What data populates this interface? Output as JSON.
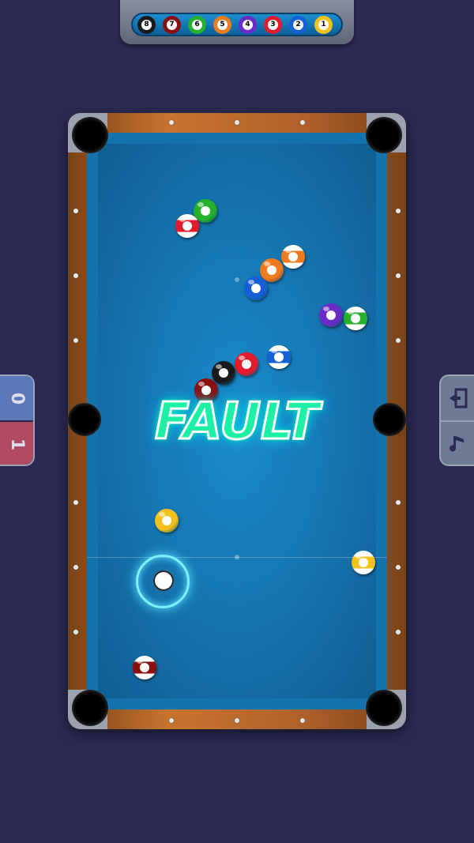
{
  "ball_tray": {
    "balls": [
      {
        "number": "8",
        "color": "#1a1a1a"
      },
      {
        "number": "7",
        "color": "#8a1010"
      },
      {
        "number": "6",
        "color": "#25b02d"
      },
      {
        "number": "5",
        "color": "#f07a1e"
      },
      {
        "number": "4",
        "color": "#6a2bc9"
      },
      {
        "number": "3",
        "color": "#e31b2d"
      },
      {
        "number": "2",
        "color": "#1560d6"
      },
      {
        "number": "1",
        "color": "#f2c21a"
      }
    ]
  },
  "scoreboard": {
    "player_top": {
      "score": "0",
      "color": "#5d78b8"
    },
    "player_bottom": {
      "score": "1",
      "color": "#b04a63"
    }
  },
  "controls": {
    "exit_icon": "exit-door-icon",
    "music_icon": "music-note-icon"
  },
  "message": {
    "text": "FAULT"
  },
  "table_balls": [
    {
      "name": "ball-green",
      "color": "#25b02d",
      "striped": false
    },
    {
      "name": "ball-red-stripe",
      "color": "#e31b2d",
      "striped": true
    },
    {
      "name": "ball-orange-stripe",
      "color": "#f07a1e",
      "striped": true
    },
    {
      "name": "ball-orange",
      "color": "#f07a1e",
      "striped": false
    },
    {
      "name": "ball-blue",
      "color": "#1560d6",
      "striped": false
    },
    {
      "name": "ball-purple",
      "color": "#6a2bc9",
      "striped": false
    },
    {
      "name": "ball-green-stripe",
      "color": "#25b02d",
      "striped": true
    },
    {
      "name": "ball-blue-stripe",
      "color": "#1560d6",
      "striped": true
    },
    {
      "name": "ball-red",
      "color": "#e31b2d",
      "striped": false
    },
    {
      "name": "ball-black",
      "color": "#1a1a1a",
      "striped": false
    },
    {
      "name": "ball-maroon",
      "color": "#8a1010",
      "striped": false
    },
    {
      "name": "ball-yellow",
      "color": "#f2c21a",
      "striped": false
    },
    {
      "name": "ball-yellow-stripe",
      "color": "#f2c21a",
      "striped": true
    },
    {
      "name": "ball-maroon-stripe",
      "color": "#8a1010",
      "striped": true
    }
  ],
  "cue_ball": {
    "color": "#ffffff"
  }
}
